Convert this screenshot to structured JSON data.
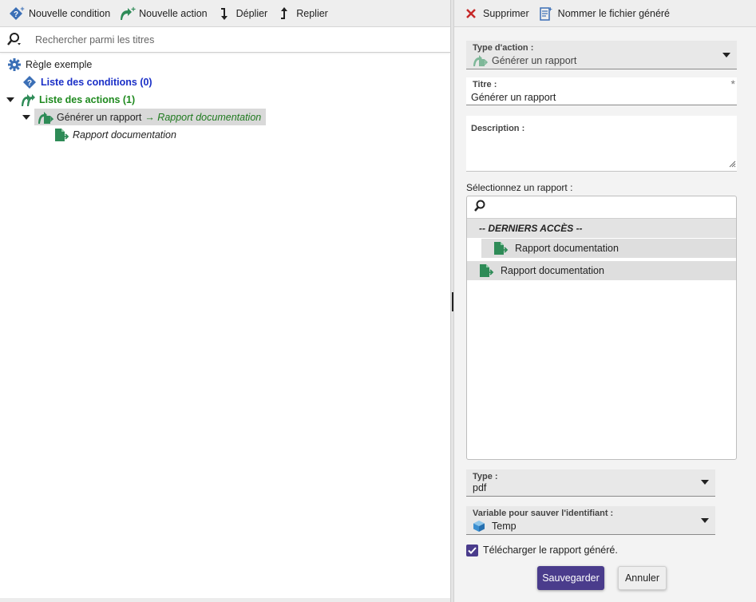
{
  "colors": {
    "accent": "#4a3c8c",
    "condition_blue": "#1a2fc7",
    "action_green": "#1f8a1f",
    "report_green": "#2e8b57",
    "delete_red": "#c62828"
  },
  "left_toolbar": {
    "new_condition": "Nouvelle condition",
    "new_action": "Nouvelle action",
    "expand": "Déplier",
    "collapse": "Replier"
  },
  "search": {
    "placeholder": "Rechercher parmi les titres"
  },
  "tree": {
    "rule": "Règle exemple",
    "conditions_list": "Liste des conditions (0)",
    "actions_list": "Liste des actions (1)",
    "action_item": "Générer un rapport",
    "action_target": "→ Rapport documentation",
    "action_child": "Rapport documentation"
  },
  "right_toolbar": {
    "delete": "Supprimer",
    "name_file": "Nommer le fichier généré"
  },
  "form": {
    "action_type_label": "Type d'action :",
    "action_type_value": "Générer un rapport",
    "title_label": "Titre :",
    "title_value": "Générer un rapport",
    "required_mark": "*",
    "description_label": "Description :",
    "select_report_label": "Sélectionnez un rapport :",
    "recent_group": "-- DERNIERS ACCÈS --",
    "recent_item": "Rapport documentation",
    "report_item": "Rapport documentation",
    "type_label": "Type :",
    "type_value": "pdf",
    "variable_label": "Variable pour sauver l'identifiant :",
    "variable_value": "Temp",
    "download_label": "Télécharger le rapport généré.",
    "download_checked": true,
    "save_label": "Sauvegarder",
    "cancel_label": "Annuler"
  }
}
